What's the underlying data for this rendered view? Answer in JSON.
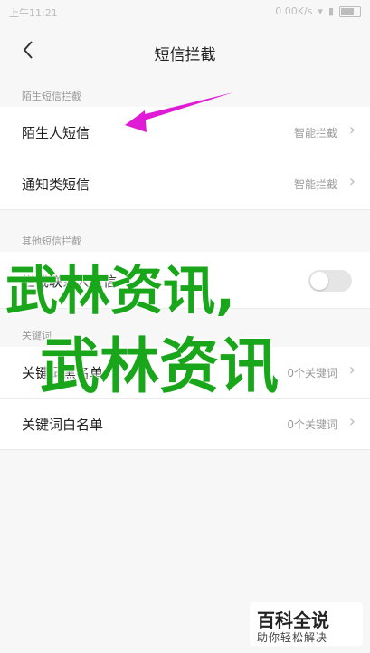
{
  "status_bar": {
    "time": "上午11:21",
    "network": "0.00K/s"
  },
  "header": {
    "title": "短信拦截"
  },
  "sections": [
    {
      "header": "陌生短信拦截",
      "rows": [
        {
          "label": "陌生人短信",
          "value": "智能拦截"
        },
        {
          "label": "通知类短信",
          "value": "智能拦截"
        }
      ]
    },
    {
      "header": "其他短信拦截",
      "rows": [
        {
          "label": "拦截联系人短信"
        }
      ]
    },
    {
      "header": "关键词",
      "rows": [
        {
          "label": "关键词黑名单",
          "value": "0个关键词"
        },
        {
          "label": "关键词白名单",
          "value": "0个关键词"
        }
      ]
    }
  ],
  "overlay": {
    "watermark_line1": "武林资讯,",
    "watermark_line2": "武林资讯",
    "logo_title": "百科全说",
    "logo_subtitle": "助你轻松解决"
  },
  "colors": {
    "arrow": "#e01bd6",
    "watermark": "#1aa61a"
  }
}
